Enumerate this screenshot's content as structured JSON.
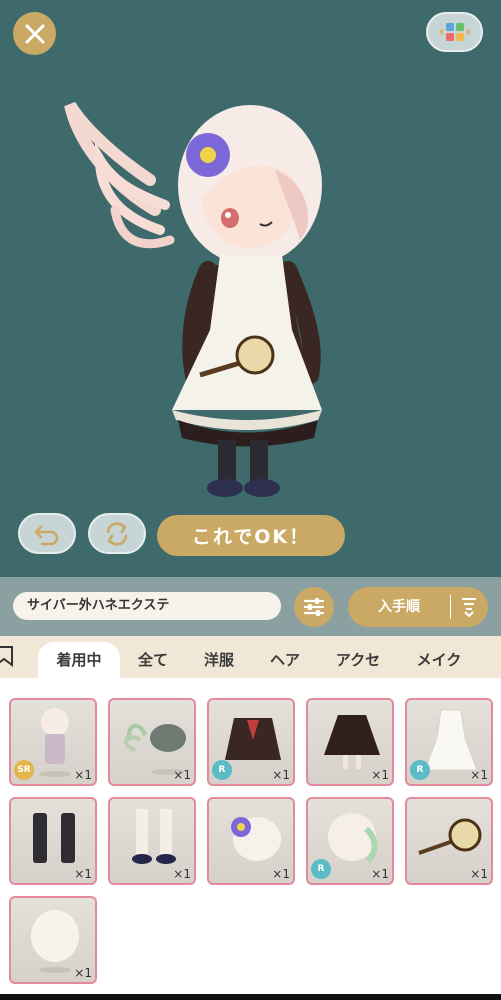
{
  "stage": {
    "ok_label": "これでOK！",
    "close_icon": "close-icon",
    "palette_icon": "color-grid-icon",
    "undo_icon": "undo-icon",
    "random_icon": "shuffle-icon"
  },
  "filter": {
    "search_value": "サイバー外ハネエクステ",
    "settings_icon": "sliders-icon",
    "sort_label": "入手順",
    "sort_icon": "sort-order-icon"
  },
  "tabs": [
    {
      "label": "着用中",
      "active": true
    },
    {
      "label": "全て"
    },
    {
      "label": "洋服"
    },
    {
      "label": "ヘア"
    },
    {
      "label": "アクセ"
    },
    {
      "label": "メイク"
    }
  ],
  "items": [
    {
      "name": "full-outfit",
      "qty": "×1",
      "badge": "SR"
    },
    {
      "name": "tentacle-hair-extension",
      "qty": "×1",
      "badge": ""
    },
    {
      "name": "sailor-top",
      "qty": "×1",
      "badge": "R"
    },
    {
      "name": "dark-skirt",
      "qty": "×1",
      "badge": ""
    },
    {
      "name": "maid-apron",
      "qty": "×1",
      "badge": "R"
    },
    {
      "name": "black-knee-socks",
      "qty": "×1",
      "badge": ""
    },
    {
      "name": "loafers",
      "qty": "×1",
      "badge": ""
    },
    {
      "name": "flower-hairpin",
      "qty": "×1",
      "badge": ""
    },
    {
      "name": "gradient-hair",
      "qty": "×1",
      "badge": "R"
    },
    {
      "name": "tambourine-item",
      "qty": "×1",
      "badge": ""
    },
    {
      "name": "base-hairstyle",
      "qty": "×1",
      "badge": ""
    }
  ],
  "colors": {
    "stage_bg": "#3e6a6c",
    "gold": "#c9a964",
    "card_border": "#e38b9d",
    "tab_bar": "#f1e7d6"
  }
}
